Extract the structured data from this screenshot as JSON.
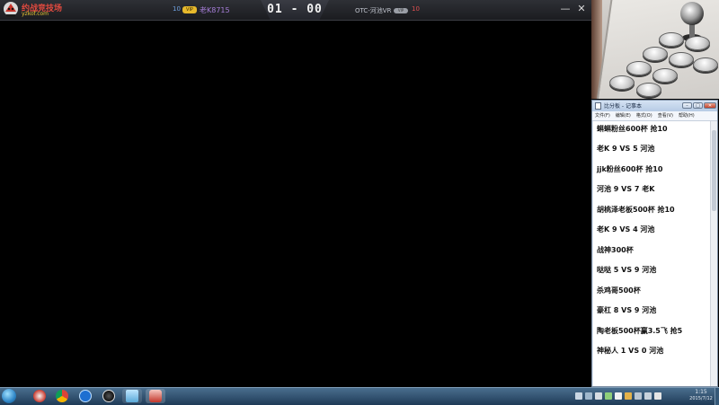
{
  "topbar": {
    "brand_title": "约战竞技场",
    "brand_url": "yzkof.com",
    "p1_level": "10",
    "p1_badge": "VIP",
    "p1_name": "老K8715",
    "score": "01 - 00",
    "p2_name": "OTC-河池VR",
    "p2_badge": "VIP",
    "p2_level": "10",
    "minimize_symbol": "—",
    "close_symbol": "✕"
  },
  "notepad": {
    "title": "比分板 - 记事本",
    "menus": [
      "文件(F)",
      "编辑(E)",
      "格式(O)",
      "查看(V)",
      "帮助(H)"
    ],
    "controls": {
      "minimize": "–",
      "maximize": "□",
      "close": "✕"
    },
    "lines": [
      "蝌蝌粉丝600杯 抢10",
      "老K 9 VS 5 河池",
      "jjk粉丝600杯 抢10",
      "河池 9 VS 7 老K",
      "胡桃泽老板500杯 抢10",
      "老K 9 VS 4 河池",
      "战神300杯",
      "哒哒 5 VS 9 河池",
      "杀鸡哥500杯",
      "豪杠 8 VS 9 河池",
      "陶老板500杯赢3.5飞 抢5",
      "神秘人 1 VS 0 河池"
    ]
  },
  "taskbar": {
    "time": "1:15",
    "date": "2015/7/12",
    "icons": [
      "windows-start-icon",
      "kof-game-icon",
      "chrome-icon",
      "k-app-icon",
      "obs-icon",
      "folder-icon",
      "kof-client-icon"
    ],
    "colors": {
      "accent": "#2f86c7",
      "bar": "#1f3b57"
    }
  }
}
